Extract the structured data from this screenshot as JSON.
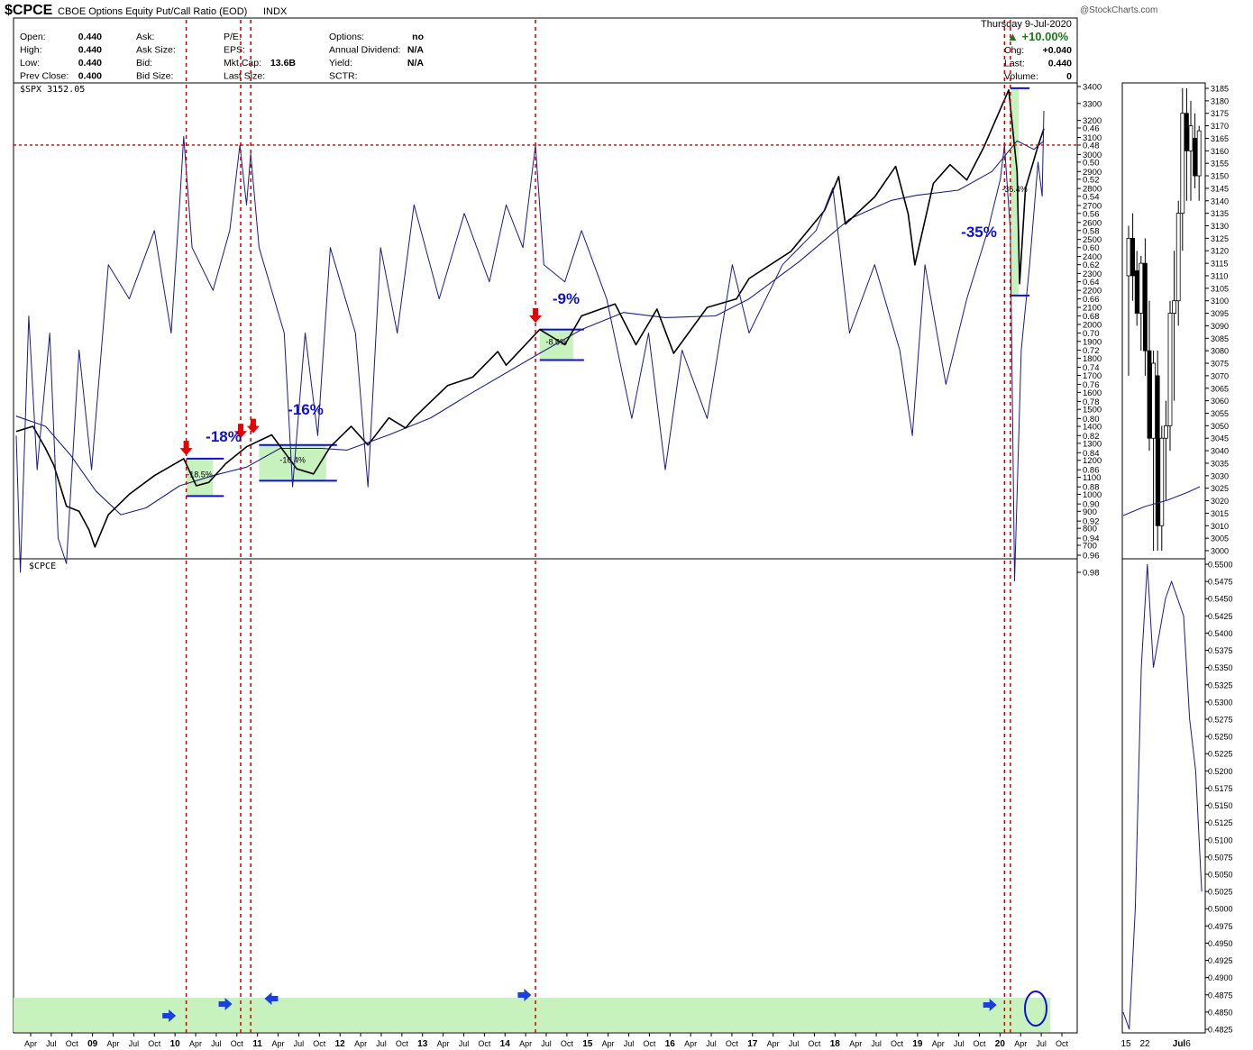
{
  "watermark": "@StockCharts.com",
  "header": {
    "symbol": "$CPCE",
    "name": "CBOE Options Equity Put/Call Ratio (EOD)",
    "exchange": "INDX",
    "date": "Thursday  9-Jul-2020",
    "change_pct": "▲ +10.00%"
  },
  "stats": {
    "col1": [
      {
        "label": "Open:",
        "value": "0.440"
      },
      {
        "label": "High:",
        "value": "0.440"
      },
      {
        "label": "Low:",
        "value": "0.440"
      },
      {
        "label": "Prev Close:",
        "value": "0.400"
      }
    ],
    "col2": [
      {
        "label": "Ask:",
        "value": ""
      },
      {
        "label": "Ask Size:",
        "value": ""
      },
      {
        "label": "Bid:",
        "value": ""
      },
      {
        "label": "Bid Size:",
        "value": ""
      }
    ],
    "col3": [
      {
        "label": "P/E:",
        "value": ""
      },
      {
        "label": "EPS:",
        "value": ""
      },
      {
        "label": "Mkt Cap:",
        "value": "13.6B"
      },
      {
        "label": "Last Size:",
        "value": ""
      }
    ],
    "col4": [
      {
        "label": "Options:",
        "value": "no"
      },
      {
        "label": "Annual Dividend:",
        "value": "N/A"
      },
      {
        "label": "Yield:",
        "value": "N/A"
      },
      {
        "label": "SCTR:",
        "value": ""
      }
    ],
    "col5": [
      {
        "label": "Chg:",
        "value": "+0.040"
      },
      {
        "label": "Last:",
        "value": "0.440"
      },
      {
        "label": "Volume:",
        "value": "0"
      }
    ]
  },
  "colors": {
    "price": "#000000",
    "ma": "#1a237e",
    "ratio": "#1a1a8c",
    "annotation": "#1010cc",
    "vline": "#d40000",
    "zone_fill": "#c7f2bd",
    "arrow_red": "#e60000",
    "arrow_blue": "#1a3ee6"
  },
  "chart_data": [
    {
      "type": "line",
      "title": "$SPX 3152.05",
      "y_ticks": [
        "3400",
        "3300",
        "3200",
        "3100",
        "3000",
        "2900",
        "2800",
        "2700",
        "2600",
        "2500",
        "2400",
        "2300",
        "2200",
        "2100",
        "2000",
        "1900",
        "1800",
        "1700",
        "1600",
        "1500",
        "1400",
        "1300",
        "1200",
        "1100",
        "1000",
        "900",
        "800",
        "700"
      ],
      "ylim": [
        650,
        3410
      ],
      "series": [
        {
          "values": [
            {
              "x": 2008.25,
              "y": 1370
            },
            {
              "x": 2008.45,
              "y": 1400
            },
            {
              "x": 2008.6,
              "y": 1270
            },
            {
              "x": 2008.7,
              "y": 1170
            },
            {
              "x": 2008.85,
              "y": 930
            },
            {
              "x": 2009.0,
              "y": 900
            },
            {
              "x": 2009.12,
              "y": 790
            },
            {
              "x": 2009.19,
              "y": 690
            },
            {
              "x": 2009.35,
              "y": 880
            },
            {
              "x": 2009.6,
              "y": 1000
            },
            {
              "x": 2009.9,
              "y": 1110
            },
            {
              "x": 2010.25,
              "y": 1210
            },
            {
              "x": 2010.4,
              "y": 1050
            },
            {
              "x": 2010.55,
              "y": 1070
            },
            {
              "x": 2010.75,
              "y": 1180
            },
            {
              "x": 2011.0,
              "y": 1280
            },
            {
              "x": 2011.3,
              "y": 1350
            },
            {
              "x": 2011.6,
              "y": 1150
            },
            {
              "x": 2011.8,
              "y": 1120
            },
            {
              "x": 2012.0,
              "y": 1280
            },
            {
              "x": 2012.25,
              "y": 1400
            },
            {
              "x": 2012.45,
              "y": 1290
            },
            {
              "x": 2012.7,
              "y": 1450
            },
            {
              "x": 2012.9,
              "y": 1390
            },
            {
              "x": 2013.0,
              "y": 1450
            },
            {
              "x": 2013.4,
              "y": 1640
            },
            {
              "x": 2013.7,
              "y": 1690
            },
            {
              "x": 2014.0,
              "y": 1840
            },
            {
              "x": 2014.1,
              "y": 1760
            },
            {
              "x": 2014.5,
              "y": 1970
            },
            {
              "x": 2014.8,
              "y": 1880
            },
            {
              "x": 2015.0,
              "y": 2050
            },
            {
              "x": 2015.4,
              "y": 2120
            },
            {
              "x": 2015.65,
              "y": 1880
            },
            {
              "x": 2015.9,
              "y": 2090
            },
            {
              "x": 2016.1,
              "y": 1830
            },
            {
              "x": 2016.5,
              "y": 2100
            },
            {
              "x": 2016.85,
              "y": 2150
            },
            {
              "x": 2017.0,
              "y": 2270
            },
            {
              "x": 2017.5,
              "y": 2430
            },
            {
              "x": 2017.9,
              "y": 2670
            },
            {
              "x": 2018.07,
              "y": 2870
            },
            {
              "x": 2018.15,
              "y": 2590
            },
            {
              "x": 2018.5,
              "y": 2750
            },
            {
              "x": 2018.75,
              "y": 2930
            },
            {
              "x": 2018.9,
              "y": 2650
            },
            {
              "x": 2018.98,
              "y": 2350
            },
            {
              "x": 2019.2,
              "y": 2830
            },
            {
              "x": 2019.4,
              "y": 2940
            },
            {
              "x": 2019.6,
              "y": 2850
            },
            {
              "x": 2019.8,
              "y": 3040
            },
            {
              "x": 2020.1,
              "y": 3380
            },
            {
              "x": 2020.2,
              "y": 2900
            },
            {
              "x": 2020.23,
              "y": 2240
            },
            {
              "x": 2020.3,
              "y": 2800
            },
            {
              "x": 2020.45,
              "y": 3050
            },
            {
              "x": 2020.52,
              "y": 3152
            }
          ]
        },
        {
          "values": [
            {
              "x": 2008.25,
              "y": 1460
            },
            {
              "x": 2008.6,
              "y": 1400
            },
            {
              "x": 2008.9,
              "y": 1230
            },
            {
              "x": 2009.2,
              "y": 1020
            },
            {
              "x": 2009.5,
              "y": 880
            },
            {
              "x": 2009.8,
              "y": 920
            },
            {
              "x": 2010.2,
              "y": 1050
            },
            {
              "x": 2010.6,
              "y": 1110
            },
            {
              "x": 2011.0,
              "y": 1160
            },
            {
              "x": 2011.4,
              "y": 1270
            },
            {
              "x": 2011.9,
              "y": 1270
            },
            {
              "x": 2012.2,
              "y": 1260
            },
            {
              "x": 2012.7,
              "y": 1350
            },
            {
              "x": 2013.2,
              "y": 1450
            },
            {
              "x": 2013.7,
              "y": 1600
            },
            {
              "x": 2014.5,
              "y": 1830
            },
            {
              "x": 2015.0,
              "y": 1970
            },
            {
              "x": 2015.5,
              "y": 2070
            },
            {
              "x": 2016.0,
              "y": 2040
            },
            {
              "x": 2016.6,
              "y": 2050
            },
            {
              "x": 2017.0,
              "y": 2150
            },
            {
              "x": 2017.6,
              "y": 2370
            },
            {
              "x": 2018.2,
              "y": 2620
            },
            {
              "x": 2018.7,
              "y": 2730
            },
            {
              "x": 2019.0,
              "y": 2760
            },
            {
              "x": 2019.5,
              "y": 2790
            },
            {
              "x": 2019.9,
              "y": 2900
            },
            {
              "x": 2020.2,
              "y": 3080
            },
            {
              "x": 2020.4,
              "y": 3030
            },
            {
              "x": 2020.52,
              "y": 3080
            }
          ]
        }
      ],
      "annotations": [
        "-18%",
        "-16%",
        "-9%",
        "-35%"
      ],
      "box_labels": [
        "-18.5%",
        "-16.4%",
        "-8.6%",
        "-36.4%"
      ]
    },
    {
      "type": "line",
      "title": "$CPCE",
      "y_ticks": [
        "0.98",
        "0.96",
        "0.94",
        "0.92",
        "0.90",
        "0.88",
        "0.86",
        "0.84",
        "0.82",
        "0.80",
        "0.78",
        "0.76",
        "0.74",
        "0.72",
        "0.70",
        "0.68",
        "0.66",
        "0.64",
        "0.62",
        "0.60",
        "0.58",
        "0.56",
        "0.54",
        "0.52",
        "0.50",
        "0.48",
        "0.46"
      ],
      "ylim": [
        0.44,
        0.99
      ],
      "series": [
        {
          "values": [
            {
              "x": 2008.25,
              "y": 0.82
            },
            {
              "x": 2008.3,
              "y": 0.98
            },
            {
              "x": 2008.4,
              "y": 0.68
            },
            {
              "x": 2008.5,
              "y": 0.86
            },
            {
              "x": 2008.65,
              "y": 0.7
            },
            {
              "x": 2008.75,
              "y": 0.94
            },
            {
              "x": 2008.85,
              "y": 0.97
            },
            {
              "x": 2009.0,
              "y": 0.72
            },
            {
              "x": 2009.15,
              "y": 0.86
            },
            {
              "x": 2009.35,
              "y": 0.62
            },
            {
              "x": 2009.6,
              "y": 0.66
            },
            {
              "x": 2009.9,
              "y": 0.58
            },
            {
              "x": 2010.1,
              "y": 0.7
            },
            {
              "x": 2010.2,
              "y": 0.55
            },
            {
              "x": 2010.25,
              "y": 0.47
            },
            {
              "x": 2010.35,
              "y": 0.6
            },
            {
              "x": 2010.6,
              "y": 0.65
            },
            {
              "x": 2010.8,
              "y": 0.58
            },
            {
              "x": 2010.92,
              "y": 0.48
            },
            {
              "x": 2011.0,
              "y": 0.55
            },
            {
              "x": 2011.05,
              "y": 0.49
            },
            {
              "x": 2011.15,
              "y": 0.6
            },
            {
              "x": 2011.45,
              "y": 0.7
            },
            {
              "x": 2011.55,
              "y": 0.88
            },
            {
              "x": 2011.7,
              "y": 0.7
            },
            {
              "x": 2011.85,
              "y": 0.82
            },
            {
              "x": 2012.0,
              "y": 0.6
            },
            {
              "x": 2012.3,
              "y": 0.7
            },
            {
              "x": 2012.45,
              "y": 0.88
            },
            {
              "x": 2012.6,
              "y": 0.6
            },
            {
              "x": 2012.8,
              "y": 0.7
            },
            {
              "x": 2013.0,
              "y": 0.55
            },
            {
              "x": 2013.3,
              "y": 0.66
            },
            {
              "x": 2013.6,
              "y": 0.56
            },
            {
              "x": 2013.9,
              "y": 0.64
            },
            {
              "x": 2014.1,
              "y": 0.55
            },
            {
              "x": 2014.3,
              "y": 0.6
            },
            {
              "x": 2014.45,
              "y": 0.48
            },
            {
              "x": 2014.55,
              "y": 0.62
            },
            {
              "x": 2014.8,
              "y": 0.64
            },
            {
              "x": 2015.0,
              "y": 0.58
            },
            {
              "x": 2015.3,
              "y": 0.66
            },
            {
              "x": 2015.6,
              "y": 0.8
            },
            {
              "x": 2015.8,
              "y": 0.7
            },
            {
              "x": 2016.0,
              "y": 0.86
            },
            {
              "x": 2016.2,
              "y": 0.72
            },
            {
              "x": 2016.5,
              "y": 0.8
            },
            {
              "x": 2016.8,
              "y": 0.62
            },
            {
              "x": 2017.0,
              "y": 0.7
            },
            {
              "x": 2017.4,
              "y": 0.62
            },
            {
              "x": 2017.8,
              "y": 0.58
            },
            {
              "x": 2018.0,
              "y": 0.53
            },
            {
              "x": 2018.2,
              "y": 0.7
            },
            {
              "x": 2018.5,
              "y": 0.62
            },
            {
              "x": 2018.8,
              "y": 0.72
            },
            {
              "x": 2018.95,
              "y": 0.82
            },
            {
              "x": 2019.1,
              "y": 0.62
            },
            {
              "x": 2019.35,
              "y": 0.76
            },
            {
              "x": 2019.6,
              "y": 0.66
            },
            {
              "x": 2019.85,
              "y": 0.58
            },
            {
              "x": 2020.0,
              "y": 0.52
            },
            {
              "x": 2020.05,
              "y": 0.48
            },
            {
              "x": 2020.12,
              "y": 0.58
            },
            {
              "x": 2020.17,
              "y": 0.99
            },
            {
              "x": 2020.25,
              "y": 0.72
            },
            {
              "x": 2020.35,
              "y": 0.62
            },
            {
              "x": 2020.45,
              "y": 0.5
            },
            {
              "x": 2020.5,
              "y": 0.54
            },
            {
              "x": 2020.52,
              "y": 0.44
            }
          ]
        }
      ],
      "threshold_marker_y": 0.48
    }
  ],
  "x_axis_labels": [
    "Apr",
    "Jul",
    "Oct",
    "09",
    "Apr",
    "Jul",
    "Oct",
    "10",
    "Apr",
    "Jul",
    "Oct",
    "11",
    "Apr",
    "Jul",
    "Oct",
    "12",
    "Apr",
    "Jul",
    "Oct",
    "13",
    "Apr",
    "Jul",
    "Oct",
    "14",
    "Apr",
    "Jul",
    "Oct",
    "15",
    "Apr",
    "Jul",
    "Oct",
    "16",
    "Apr",
    "Jul",
    "Oct",
    "17",
    "Apr",
    "Jul",
    "Oct",
    "18",
    "Apr",
    "Jul",
    "Oct",
    "19",
    "Apr",
    "Jul",
    "Oct",
    "20",
    "Apr",
    "Jul",
    "Oct"
  ],
  "zoom_panel": {
    "top_ticks": [
      "3185",
      "3180",
      "3175",
      "3170",
      "3165",
      "3160",
      "3155",
      "3150",
      "3145",
      "3140",
      "3135",
      "3130",
      "3125",
      "3120",
      "3115",
      "3110",
      "3105",
      "3100",
      "3095",
      "3090",
      "3085",
      "3080",
      "3075",
      "3070",
      "3065",
      "3060",
      "3055",
      "3050",
      "3045",
      "3040",
      "3035",
      "3030",
      "3025",
      "3020",
      "3015",
      "3010",
      "3005",
      "3000"
    ],
    "bottom_ticks": [
      "0.5500",
      "0.5475",
      "0.5450",
      "0.5425",
      "0.5400",
      "0.5375",
      "0.5350",
      "0.5325",
      "0.5300",
      "0.5275",
      "0.5250",
      "0.5225",
      "0.5200",
      "0.5175",
      "0.5150",
      "0.5125",
      "0.5100",
      "0.5075",
      "0.5050",
      "0.5025",
      "0.5000",
      "0.4975",
      "0.4950",
      "0.4925",
      "0.4900",
      "0.4875",
      "0.4850",
      "0.4825"
    ],
    "x_labels": [
      "15",
      "22",
      "Jul",
      "6"
    ]
  }
}
